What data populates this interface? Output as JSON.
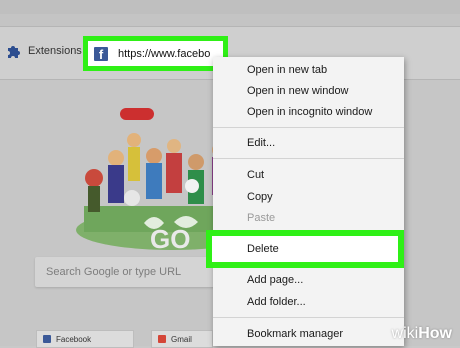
{
  "bookmarks_bar": {
    "extensions_label": "Extensions",
    "facebook_url": "https://www.facebo"
  },
  "search": {
    "placeholder": "Search Google or type URL"
  },
  "tiles": [
    {
      "label": "Facebook",
      "icon": "facebook-icon",
      "color": "#3b5998"
    },
    {
      "label": "Gmail",
      "icon": "gmail-icon",
      "color": "#d44638"
    }
  ],
  "context_menu": {
    "items": [
      {
        "label": "Open in new tab"
      },
      {
        "label": "Open in new window"
      },
      {
        "label": "Open in incognito window"
      },
      {
        "label": "Edit..."
      },
      {
        "label": "Cut"
      },
      {
        "label": "Copy"
      },
      {
        "label": "Paste",
        "disabled": true
      },
      {
        "label": "Delete",
        "highlighted": true
      },
      {
        "label": "Add page..."
      },
      {
        "label": "Add folder..."
      },
      {
        "label": "Bookmark manager"
      }
    ]
  },
  "watermark": {
    "wiki": "wiki",
    "how": "How"
  },
  "colors": {
    "highlight_border": "#2ff016",
    "facebook_blue": "#3b5998",
    "menu_bg": "#f3f3f3"
  }
}
